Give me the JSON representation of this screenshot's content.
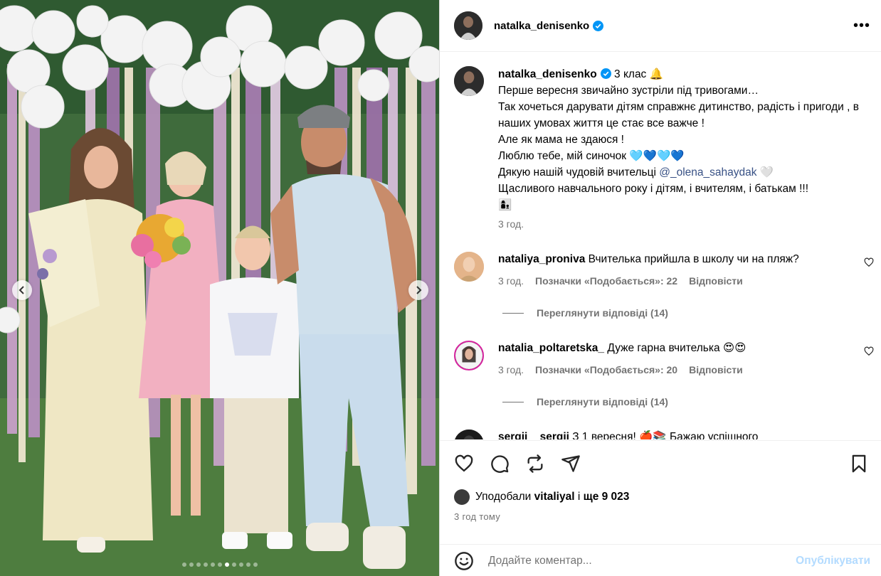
{
  "post": {
    "username": "natalka_denisenko",
    "caption_lines": [
      "3 клас 🔔",
      "Перше вересня звичайно зустріли під тривогами…",
      "Так хочеться дарувати дітям справжнє дитинство, радість і пригоди , в наших умовах життя це стає все важче !",
      "Але як мама не здаюся !",
      "Люблю тебе, мій синочок 🩵💙🩵💙",
      "Дякую нашій чудовій вчительці",
      "Щасливого навчального року і дітям, і вчителям, і батькам !!!",
      "👩‍👦"
    ],
    "mention": "@_olena_sahaydak",
    "mention_suffix": "🤍",
    "caption_time": "3 год."
  },
  "comments": [
    {
      "username": "nataliya_proniva",
      "text": "Вчителька прийшла в школу чи на пляж?",
      "time": "3 год.",
      "likes_label": "Позначки «Подобається»: 22",
      "reply_label": "Відповісти",
      "view_replies": "Переглянути відповіді (14)"
    },
    {
      "username": "natalia_poltaretska_",
      "text": "Дуже гарна вчителька 😍😍",
      "time": "3 год.",
      "likes_label": "Позначки «Подобається»: 20",
      "reply_label": "Відповісти",
      "view_replies": "Переглянути відповіді (14)"
    },
    {
      "username": "sergii__sergii",
      "text": "З 1 вересня! 🍎📚 Бажаю успішного"
    }
  ],
  "likes": {
    "prefix": "Уподобали",
    "user": "vitaliyal",
    "mid": "і",
    "count": "ще 9 023"
  },
  "timestamp": "3 год тому",
  "composer": {
    "placeholder": "Додайте коментар...",
    "post_label": "Опублікувати"
  },
  "carousel": {
    "total": 11,
    "active_index": 6
  },
  "colors": {
    "link": "#385185",
    "meta": "#737373",
    "post_button_disabled": "#b3dbff",
    "verified": "#0095f6"
  }
}
